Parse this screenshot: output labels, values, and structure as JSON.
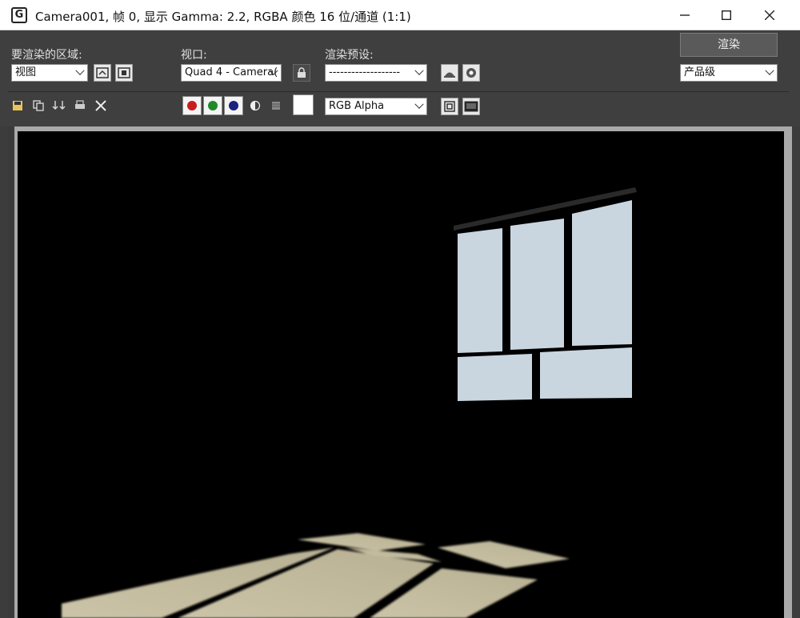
{
  "window": {
    "title": "Camera001, 帧 0, 显示 Gamma: 2.2, RGBA 颜色 16 位/通道 (1:1)",
    "app_icon": "G",
    "buttons": [
      "minimize-icon",
      "maximize-icon",
      "close-icon"
    ]
  },
  "toolbar": {
    "area_label": "要渲染的区域:",
    "area_value": "视图",
    "viewport_label": "视口:",
    "viewport_value": "Quad 4 - Camera(",
    "preset_label": "渲染预设:",
    "preset_value": "-------------------",
    "render_button": "渲染",
    "quality_value": "产品级",
    "channel_value": "RGB Alpha",
    "channels": [
      {
        "name": "red-channel",
        "color": "#c81e1e"
      },
      {
        "name": "green-channel",
        "color": "#1e8a2a"
      },
      {
        "name": "blue-channel",
        "color": "#1a237e"
      }
    ],
    "swatch_color": "#ffffff"
  },
  "scene": {
    "background": "#000000",
    "window_glass_color": "#c9d6e0",
    "floor_light_color": "#cbc4a8"
  }
}
